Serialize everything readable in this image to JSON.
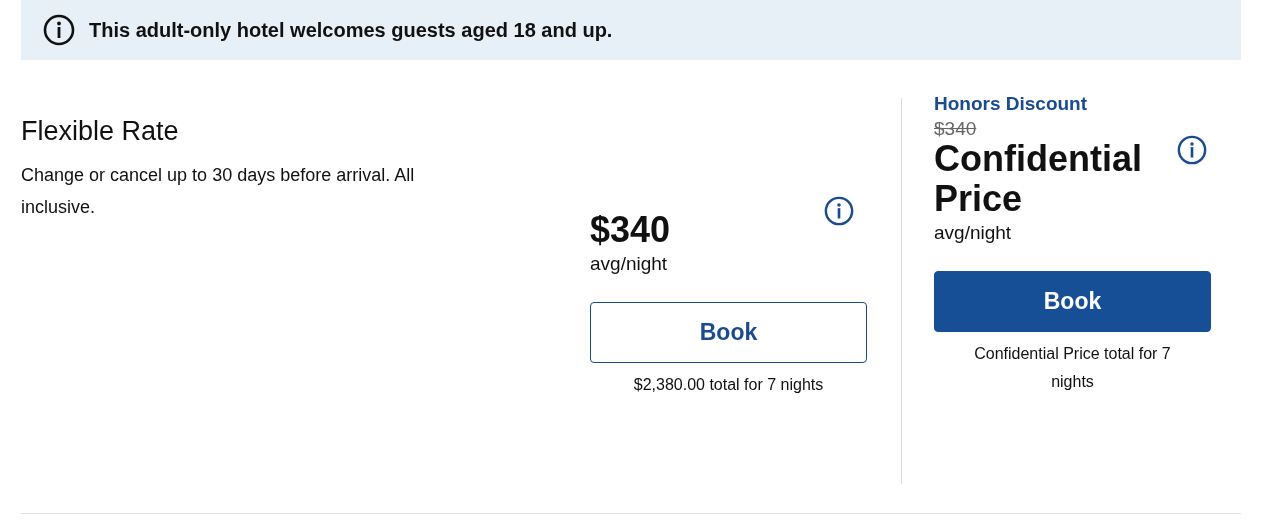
{
  "notice": {
    "text": "This adult-only hotel welcomes guests aged 18 and up."
  },
  "rate": {
    "title": "Flexible Rate",
    "description": "Change or cancel up to 30 days before arrival. All inclusive."
  },
  "offers": [
    {
      "kind": "standard",
      "price": "$340",
      "price_unit": "avg/night",
      "button": {
        "label": "Book"
      },
      "total": "$2,380.00 total for 7 nights"
    },
    {
      "kind": "discount",
      "label": "Honors Discount",
      "original_price": "$340",
      "price": "Confidential Price",
      "price_unit": "avg/night",
      "button": {
        "label": "Book"
      },
      "total": "Confidential Price total for 7 nights"
    }
  ]
}
